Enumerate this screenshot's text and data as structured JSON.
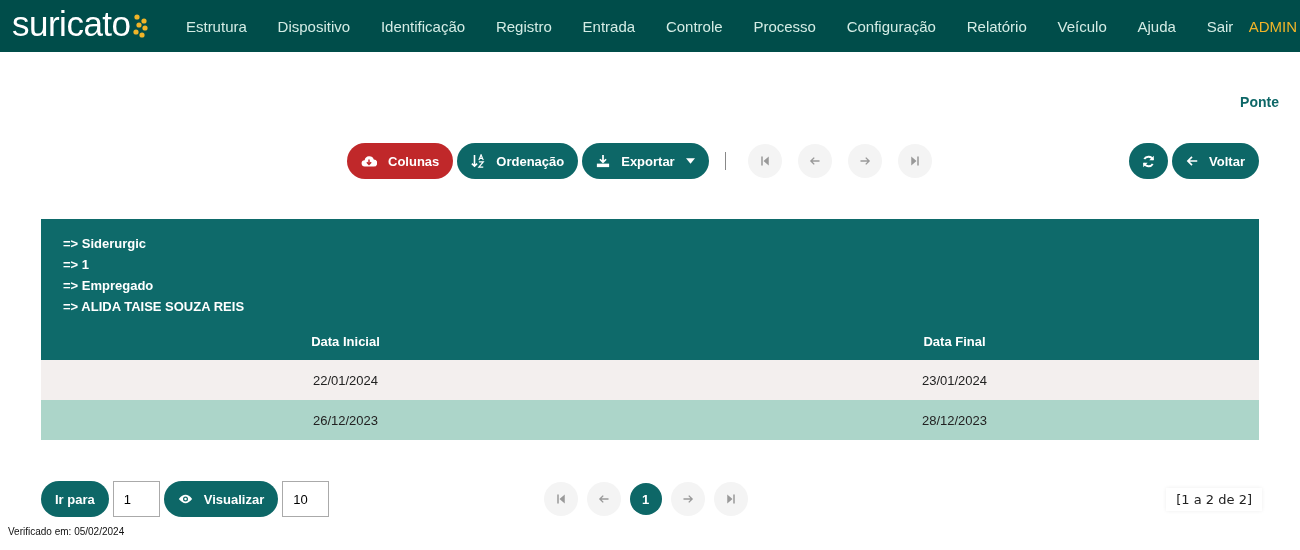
{
  "header": {
    "logo": "suricato",
    "menu": [
      {
        "label": "Estrutura"
      },
      {
        "label": "Dispositivo"
      },
      {
        "label": "Identificação"
      },
      {
        "label": "Registro"
      },
      {
        "label": "Entrada"
      },
      {
        "label": "Controle"
      },
      {
        "label": "Processo"
      },
      {
        "label": "Configuração"
      },
      {
        "label": "Relatório"
      },
      {
        "label": "Veículo"
      },
      {
        "label": "Ajuda"
      },
      {
        "label": "Sair"
      }
    ],
    "user": "ADMIN"
  },
  "page_title": "Ponte",
  "toolbar": {
    "columns_button": {
      "label": "Colunas"
    },
    "sort_button": {
      "label": "Ordenação"
    },
    "export_button": {
      "label": "Exportar"
    },
    "nav_buttons": [
      {
        "disabled": true
      },
      {
        "disabled": true
      },
      {
        "disabled": true
      },
      {
        "disabled": true
      }
    ],
    "back_button": {
      "label": "Voltar"
    }
  },
  "table": {
    "group_lines": [
      "=> Siderurgic",
      "=> 1",
      "=> Empregado",
      "=> ALIDA TAISE SOUZA REIS"
    ],
    "columns": [
      "Data Inicial",
      "Data Final"
    ],
    "rows": [
      {
        "cells": [
          "22/01/2024",
          "23/01/2024"
        ],
        "selected": false
      },
      {
        "cells": [
          "26/12/2023",
          "28/12/2023"
        ],
        "selected": true
      }
    ]
  },
  "pager": {
    "goto_button": {
      "label": "Ir para"
    },
    "goto_value": "1",
    "view_button": {
      "label": "Visualizar"
    },
    "view_value": "10",
    "nav_buttons": [
      {
        "disabled": true
      },
      {
        "disabled": true
      },
      {
        "disabled": true
      },
      {
        "disabled": true
      }
    ],
    "pages": [
      {
        "label": "1",
        "selected": true
      }
    ],
    "range": "[1 a 2 de 2]"
  },
  "footer": "Verificado em: 05/02/2024"
}
